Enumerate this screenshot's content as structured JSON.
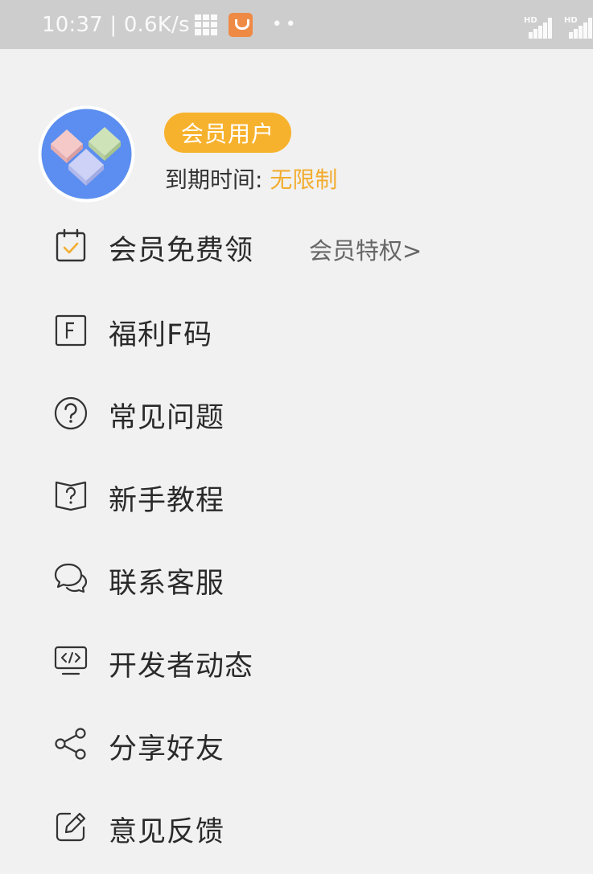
{
  "status_bar": {
    "time_speed": "10:37 | 0.6K/s",
    "signal_label": "HD"
  },
  "profile": {
    "avatar_icon": "three-overlapping-diamonds-logo",
    "badge": "会员用户",
    "expire_label": "到期时间: ",
    "expire_value": "无限制"
  },
  "menu": {
    "items": [
      {
        "label": "会员免费领",
        "icon": "clipboard-check-icon",
        "extra": "会员特权>"
      },
      {
        "label": "福利F码",
        "icon": "f-code-icon"
      },
      {
        "label": "常见问题",
        "icon": "question-circle-icon"
      },
      {
        "label": "新手教程",
        "icon": "book-question-icon"
      },
      {
        "label": "联系客服",
        "icon": "chat-bubbles-icon"
      },
      {
        "label": "开发者动态",
        "icon": "monitor-code-icon"
      },
      {
        "label": "分享好友",
        "icon": "share-icon"
      },
      {
        "label": "意见反馈",
        "icon": "edit-pen-icon"
      }
    ]
  },
  "colors": {
    "accent": "#f7b22d",
    "accent_text": "#f2ad30",
    "status_bar": "#cdcdcd",
    "background": "#f1f1f1",
    "avatar_blue": "#5b8ef0"
  }
}
